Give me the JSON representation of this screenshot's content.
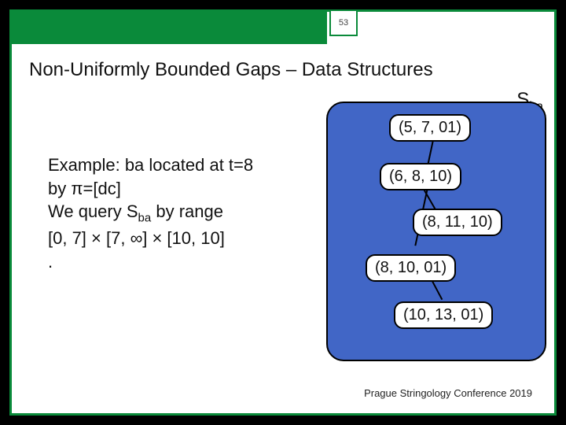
{
  "page_number": "53",
  "title": "Non-Uniformly Bounded Gaps – Data Structures",
  "s_label": "S",
  "s_sub": "ba",
  "body": {
    "line1": "Example: ba located at t=8",
    "line2": "by π=[dc]",
    "line3a": "We query  S",
    "line3sub": "ba",
    "line3b": " by range",
    "line4": " [0, 7] × [7, ∞] × [10, 10]",
    "line5": "."
  },
  "nodes": {
    "n1": "(5, 7, 01)",
    "n2": "(6, 8, 10)",
    "n3": "(8, 11, 10)",
    "n4": "(8, 10, 01)",
    "n5": "(10, 13, 01)"
  },
  "footer": "Prague Stringology Conference 2019"
}
